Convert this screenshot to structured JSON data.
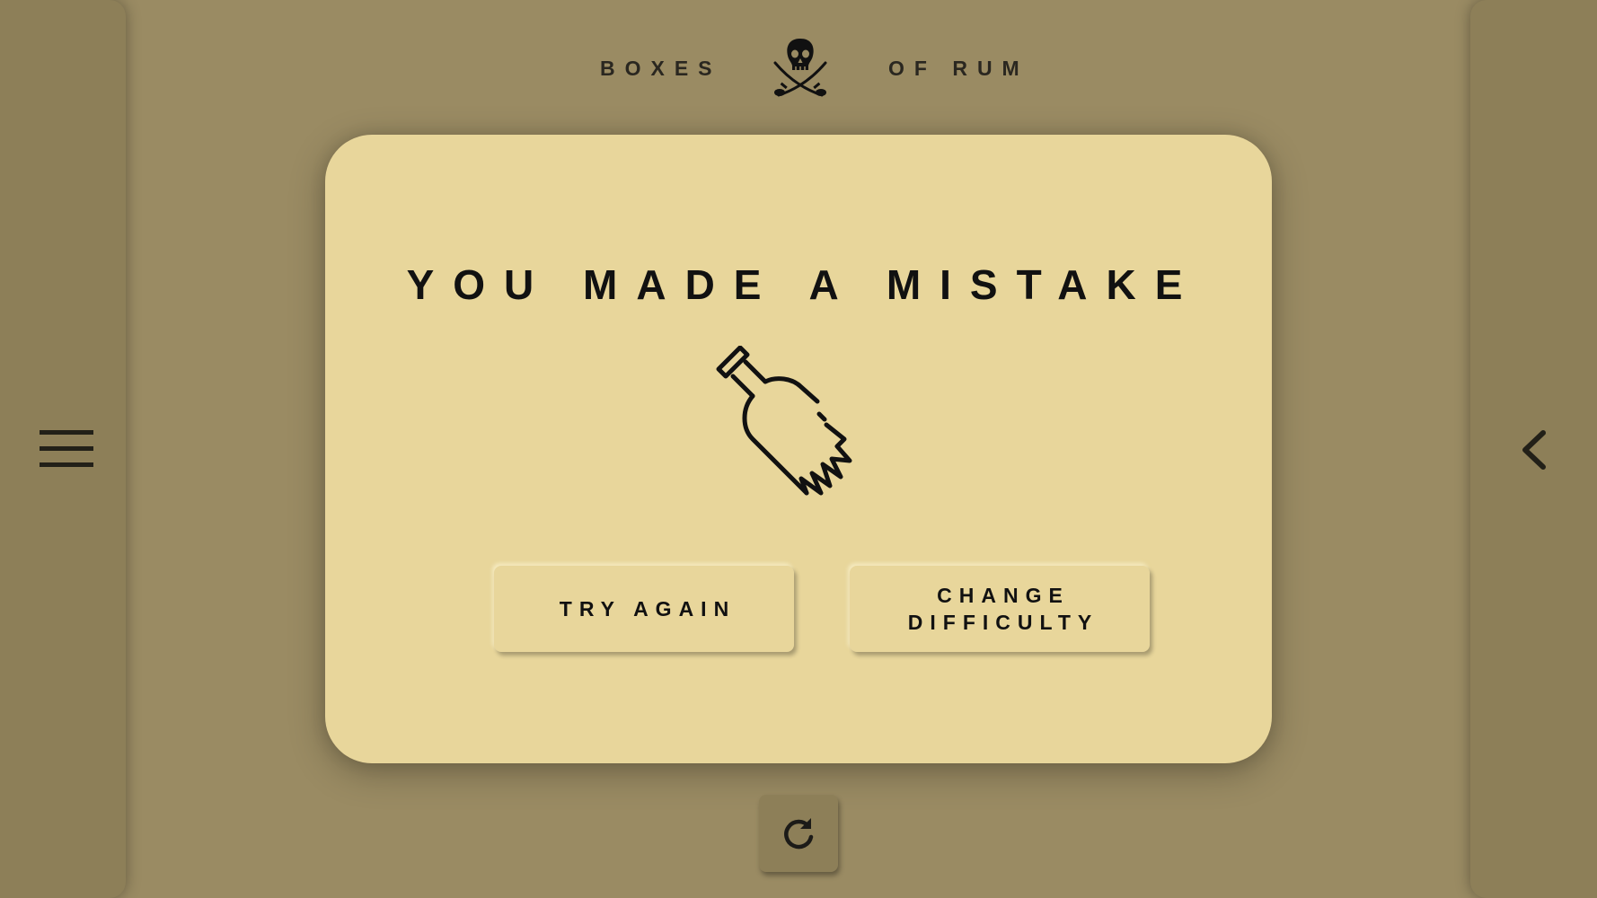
{
  "header": {
    "left_word": "BOXES",
    "right_word": "OF RUM",
    "logo_icon": "skull-crossed-swords-icon"
  },
  "modal": {
    "title": "YOU MADE A MISTAKE",
    "illustration_icon": "broken-bottle-icon",
    "buttons": {
      "try_again": "TRY AGAIN",
      "change_difficulty_line1": "CHANGE",
      "change_difficulty_line2": "DIFFICULTY"
    }
  },
  "controls": {
    "menu_icon": "hamburger-menu-icon",
    "back_icon": "chevron-left-icon",
    "restart_icon": "restart-icon"
  },
  "colors": {
    "background": "#9a8b63",
    "side_panel": "#8d7f58",
    "card": "#e8d69b",
    "text": "#111111"
  }
}
